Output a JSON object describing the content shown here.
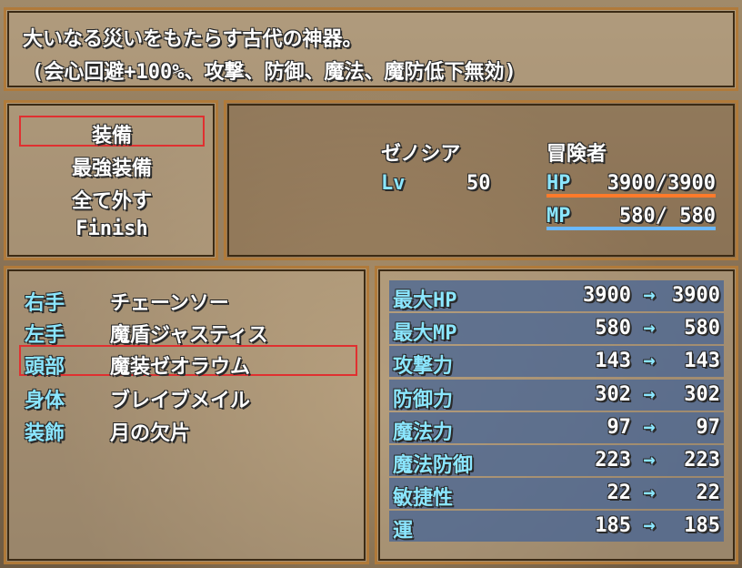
{
  "help": {
    "line1": "大いなる災いをもたらす古代の神器。",
    "line2": "(会心回避+100%、攻撃、防御、魔法、魔防低下無効)"
  },
  "command_menu": {
    "items": [
      "装備",
      "最強装備",
      "全て外す",
      "Finish"
    ],
    "selected_index": 0
  },
  "actor": {
    "name": "ゼノシア",
    "class": "冒険者",
    "level_label": "Lv",
    "level": "50",
    "hp_label": "HP",
    "hp": "3900/3900",
    "mp_label": "MP",
    "mp": "580/ 580",
    "hp_fill": 1.0,
    "mp_fill": 1.0
  },
  "equip_slots": [
    {
      "slot": "右手",
      "item": "チェーンソー"
    },
    {
      "slot": "左手",
      "item": "魔盾ジャスティス"
    },
    {
      "slot": "頭部",
      "item": "魔装ゼオラウム"
    },
    {
      "slot": "身体",
      "item": "ブレイブメイル"
    },
    {
      "slot": "装飾",
      "item": "月の欠片"
    }
  ],
  "equip_selected_index": 2,
  "params": [
    {
      "name": "最大HP",
      "cur": "3900",
      "arrow": "→",
      "new": "3900"
    },
    {
      "name": "最大MP",
      "cur": "580",
      "arrow": "→",
      "new": "580"
    },
    {
      "name": "攻撃力",
      "cur": "143",
      "arrow": "→",
      "new": "143"
    },
    {
      "name": "防御力",
      "cur": "302",
      "arrow": "→",
      "new": "302"
    },
    {
      "name": "魔法力",
      "cur": "97",
      "arrow": "→",
      "new": "97"
    },
    {
      "name": "魔法防御",
      "cur": "223",
      "arrow": "→",
      "new": "223"
    },
    {
      "name": "敏捷性",
      "cur": "22",
      "arrow": "→",
      "new": "22"
    },
    {
      "name": "運",
      "cur": "185",
      "arrow": "→",
      "new": "185"
    }
  ],
  "colors": {
    "system_text": "#8be6ff",
    "cursor": "#e03030",
    "hp_bar": "#ff7a2a",
    "mp_bar": "#6ab8ff",
    "param_row": "#46649a"
  }
}
